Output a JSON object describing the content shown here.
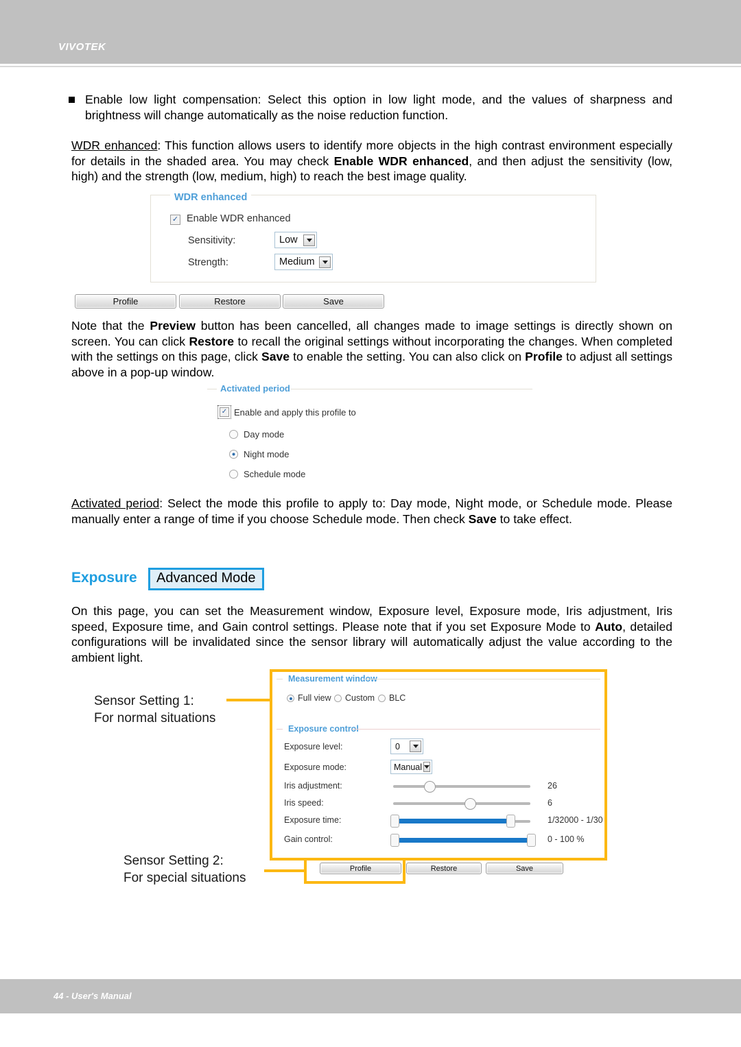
{
  "header": {
    "brand": "VIVOTEK"
  },
  "footer": {
    "page_text": "44 - User's Manual"
  },
  "body": {
    "bullet_1_line1": "Enable low light compensation: Select this option in low light mode, and the values of sharpness",
    "bullet_1_line2": "and brightness will change automatically as the noise reduction function.",
    "wdr_para_prefix": "WDR enhanced",
    "wdr_para_a": ": This function allows users to identify more objects in the high contrast environment especially for details in the shaded area. You may check ",
    "wdr_para_bold": "Enable WDR enhanced",
    "wdr_para_b": ", and then adjust the sensitivity (low, high) and the strength (low, medium, high) to reach the best image quality.",
    "note_a": "Note that the ",
    "note_b1": "Preview",
    "note_b": " button has been cancelled, all changes made to image settings is directly shown on screen. You can click ",
    "note_b2": "Restore",
    "note_c": " to recall the original settings without incorporating the changes. When completed with the settings on this page, click ",
    "note_b3": "Save",
    "note_d": " to enable the setting. You can also click on ",
    "note_b4": "Profile",
    "note_e": " to adjust all settings above in a pop-up window.",
    "activated_prefix": "Activated period",
    "activated_a": ": Select the mode this profile to apply to: Day mode, Night mode, or Schedule mode. Please manually enter a range of time if you choose Schedule mode. Then check ",
    "activated_bold": "Save",
    "activated_b": " to take effect.",
    "exposure_para_a": "On this page, you can set the Measurement window, Exposure level, Exposure mode, Iris adjustment, Iris speed, Exposure time, and Gain control settings. Please note that if you set Exposure Mode to ",
    "exposure_para_bold": "Auto",
    "exposure_para_b": ", detailed configurations will be invalidated since the sensor library will automatically adjust the value according to the ambient light."
  },
  "headings": {
    "exposure": "Exposure",
    "advanced_mode": "Advanced Mode"
  },
  "wdr_panel": {
    "legend": "WDR enhanced",
    "enable_label": "Enable WDR enhanced",
    "enable_checked_glyph": "✓",
    "sensitivity_label": "Sensitivity:",
    "sensitivity_value": "Low",
    "strength_label": "Strength:",
    "strength_value": "Medium"
  },
  "wdr_buttons": {
    "profile": "Profile",
    "restore": "Restore",
    "save": "Save"
  },
  "activated_panel": {
    "legend": "Activated period",
    "enable_label": "Enable and apply this profile to",
    "enable_checked_glyph": "✓",
    "options": [
      {
        "label": "Day mode",
        "selected": false
      },
      {
        "label": "Night mode",
        "selected": true
      },
      {
        "label": "Schedule mode",
        "selected": false
      }
    ]
  },
  "exposure_panel": {
    "measurement_legend": "Measurement window",
    "measurement_options": [
      {
        "label": "Full view",
        "selected": true
      },
      {
        "label": "Custom",
        "selected": false
      },
      {
        "label": "BLC",
        "selected": false
      }
    ],
    "exposure_legend": "Exposure control",
    "exposure_level_label": "Exposure level:",
    "exposure_level_value": "0",
    "exposure_mode_label": "Exposure mode:",
    "exposure_mode_value": "Manual",
    "iris_adjustment_label": "Iris adjustment:",
    "iris_adjustment_value": "26",
    "iris_speed_label": "Iris speed:",
    "iris_speed_value": "6",
    "exposure_time_label": "Exposure time:",
    "exposure_time_value": "1/32000 - 1/30",
    "gain_control_label": "Gain control:",
    "gain_control_value": "0 - 100 %"
  },
  "exposure_buttons": {
    "profile": "Profile",
    "restore": "Restore",
    "save": "Save"
  },
  "annotations": {
    "sensor1_line1": "Sensor Setting 1:",
    "sensor1_line2": "For normal situations",
    "sensor2_line1": "Sensor Setting 2:",
    "sensor2_line2": "For special situations"
  },
  "colors": {
    "brand_blue": "#1f9ee0",
    "legend_blue": "#4f9fd8",
    "callout_yellow": "#fcb813",
    "chrome_gray": "#c0c0c0",
    "slider_blue": "#1878c8"
  }
}
